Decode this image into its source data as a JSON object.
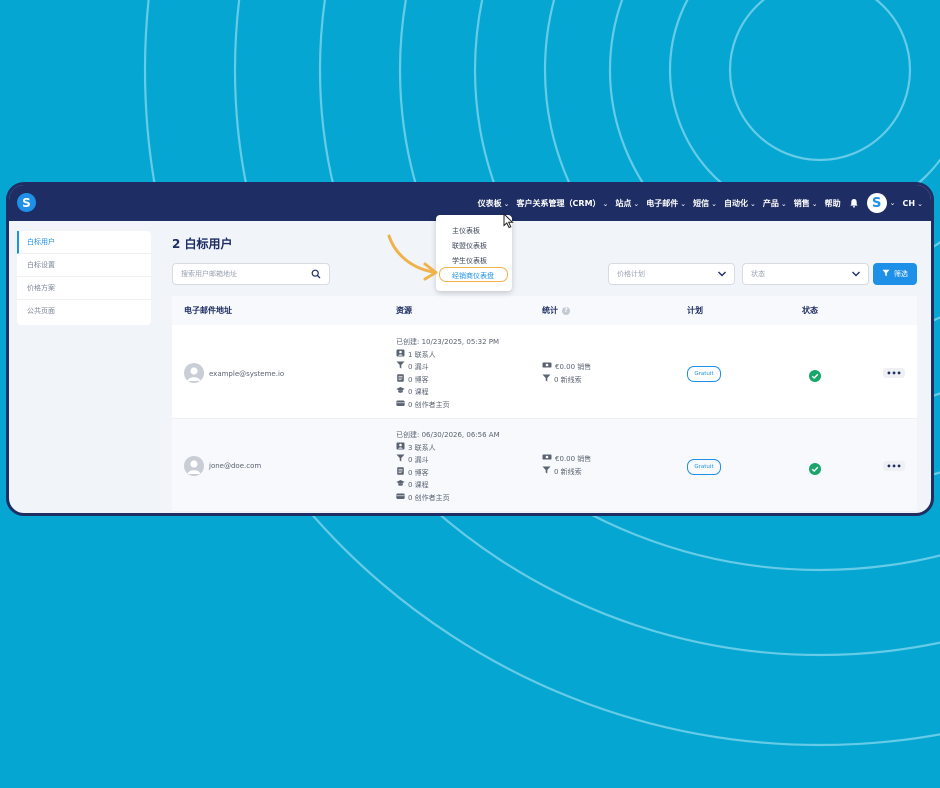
{
  "nav": {
    "items": [
      {
        "label": "仪表板",
        "chevron": true
      },
      {
        "label": "客户关系管理（CRM）",
        "chevron": true
      },
      {
        "label": "站点",
        "chevron": true
      },
      {
        "label": "电子邮件",
        "chevron": true
      },
      {
        "label": "短信",
        "chevron": true
      },
      {
        "label": "自动化",
        "chevron": true
      },
      {
        "label": "产品",
        "chevron": true
      },
      {
        "label": "销售",
        "chevron": true
      },
      {
        "label": "帮助",
        "chevron": false
      }
    ],
    "logo_letter": "S",
    "avatar_letter": "S",
    "language": "CH"
  },
  "dropdown": {
    "items": [
      "主仪表板",
      "联盟仪表板",
      "学生仪表板",
      "经销商仪表盘"
    ],
    "highlighted_index": 3
  },
  "sidebar": {
    "items": [
      {
        "label": "白标用户",
        "active": true
      },
      {
        "label": "白标设置",
        "active": false
      },
      {
        "label": "价格方案",
        "active": false
      },
      {
        "label": "公共页面",
        "active": false
      }
    ]
  },
  "main": {
    "title": "2 白标用户",
    "search_placeholder": "搜索用户邮箱地址",
    "price_plan_placeholder": "价格计划",
    "status_placeholder": "状态",
    "filter_label": "筛选"
  },
  "table": {
    "headers": {
      "email": "电子邮件地址",
      "resources": "资源",
      "stats": "统计",
      "plan": "计划",
      "status": "状态"
    },
    "rows": [
      {
        "email": "example@systeme.io",
        "created": "已创建: 10/23/2025, 05:32 PM",
        "contacts": "1 联系人",
        "funnels": "0 漏斗",
        "blogs": "0 博客",
        "courses": "0 课程",
        "creator_pages": "0 创作者主页",
        "sales": "€0.00 销售",
        "leads": "0 新线索",
        "plan": "Gratuit",
        "status": "active"
      },
      {
        "email": "jone@doe.com",
        "created": "已创建: 06/30/2026, 06:56 AM",
        "contacts": "3 联系人",
        "funnels": "0 漏斗",
        "blogs": "0 博客",
        "courses": "0 课程",
        "creator_pages": "0 创作者主页",
        "sales": "€0.00 销售",
        "leads": "0 新线索",
        "plan": "Gratuit",
        "status": "active"
      }
    ]
  },
  "colors": {
    "background": "#05a6d2",
    "navbar": "#1e2d63",
    "accent": "#1e90e8",
    "highlight": "#f0b24b",
    "success": "#1aa56b"
  }
}
